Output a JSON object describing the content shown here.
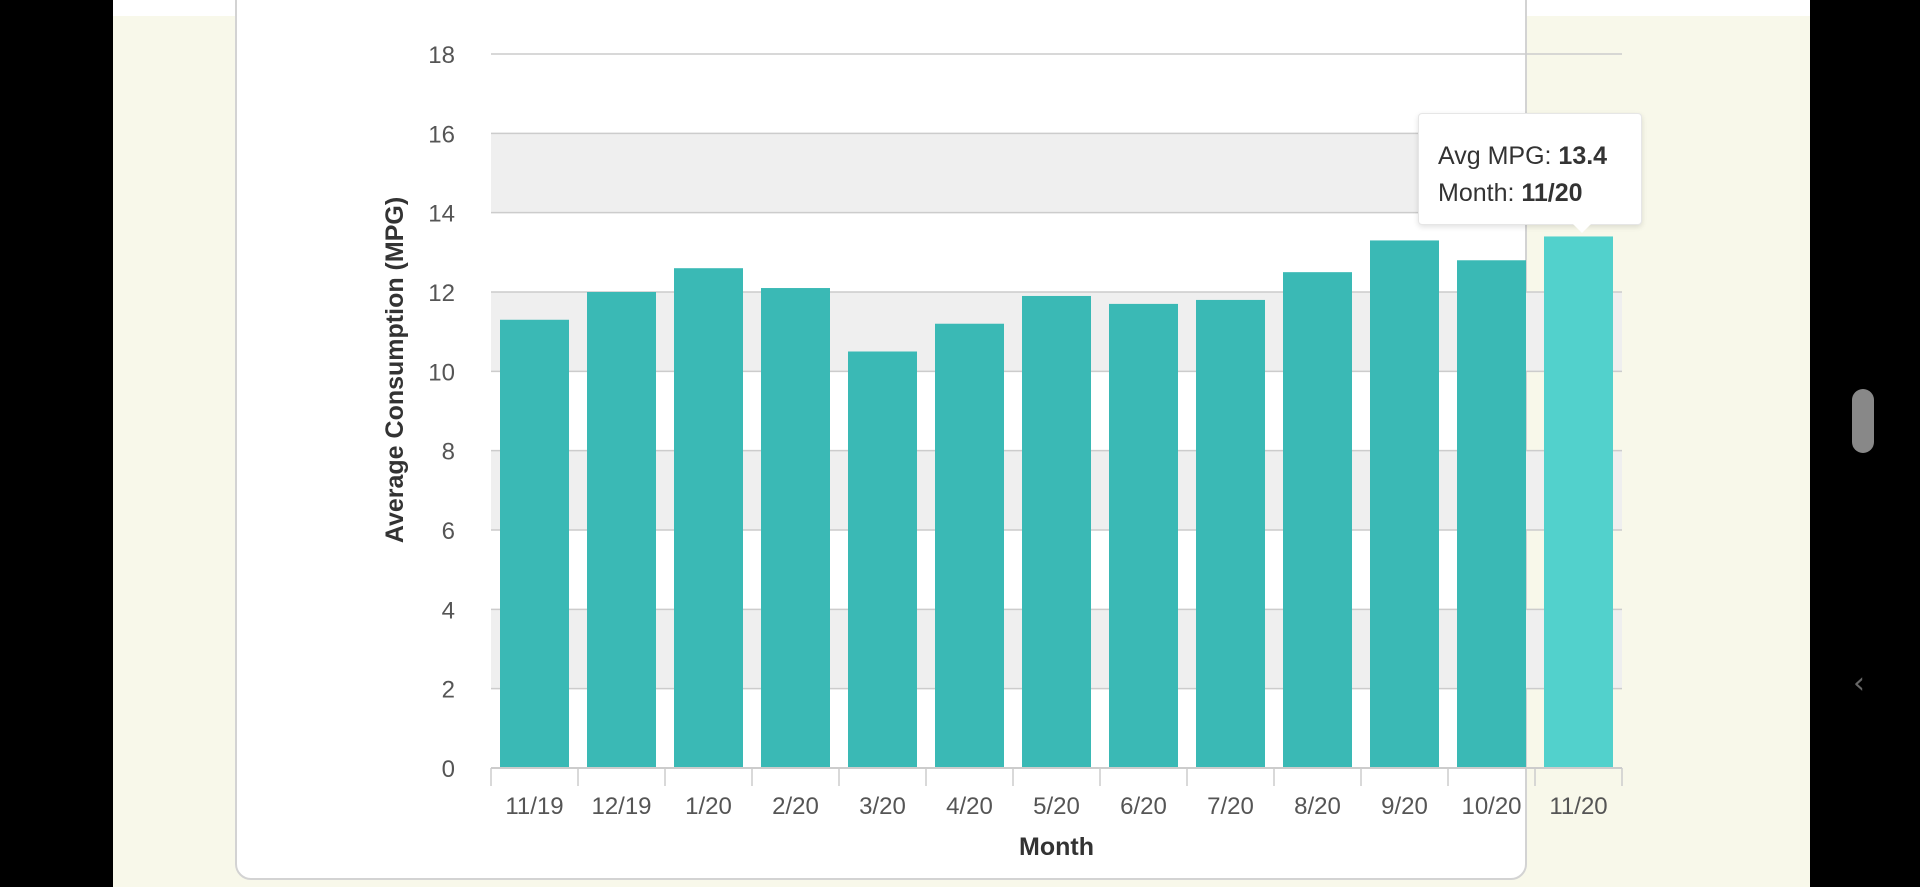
{
  "colors": {
    "bar": "#3ab9b5",
    "bar_highlight": "#52d1cc",
    "band": "#efefef",
    "grid": "#cccccc",
    "axis_text": "#555555",
    "label_text": "#333333"
  },
  "icons": {
    "scroll_handle": "scroll-handle",
    "back": "chevron-left-icon"
  },
  "back_glyph": "‹",
  "tooltip": {
    "label1": "Avg MPG: ",
    "value1": "13.4",
    "label2": "Month: ",
    "value2": "11/20"
  },
  "chart_data": {
    "type": "bar",
    "xlabel": "Month",
    "ylabel": "Average Consumption (MPG)",
    "ylim": [
      0,
      18
    ],
    "yticks": [
      0,
      2,
      4,
      6,
      8,
      10,
      12,
      14,
      16,
      18
    ],
    "grid": true,
    "categories": [
      "11/19",
      "12/19",
      "1/20",
      "2/20",
      "3/20",
      "4/20",
      "5/20",
      "6/20",
      "7/20",
      "8/20",
      "9/20",
      "10/20",
      "11/20"
    ],
    "values": [
      11.3,
      12.0,
      12.6,
      12.1,
      10.5,
      11.2,
      11.9,
      11.7,
      11.8,
      12.5,
      13.3,
      12.8,
      13.4
    ],
    "highlighted_category": "11/20"
  }
}
